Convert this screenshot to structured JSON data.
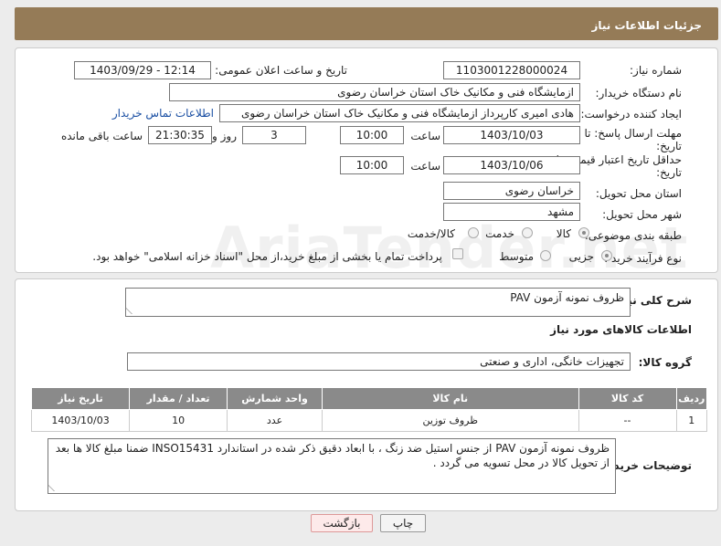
{
  "header": {
    "title": "جزئیات اطلاعات نیاز"
  },
  "fields": {
    "need_number_label": "شماره نیاز:",
    "need_number": "1103001228000024",
    "announce_label": "تاریخ و ساعت اعلان عمومی:",
    "announce_value": "1403/09/29 - 12:14",
    "buyer_org_label": "نام دستگاه خریدار:",
    "buyer_org": "ازمایشگاه فنی و مکانیک خاک استان خراسان رضوی",
    "creator_label": "ایجاد کننده درخواست:",
    "creator": "هادی  امیری کارپرداز ازمایشگاه فنی و مکانیک خاک استان خراسان رضوی",
    "contact_link": "اطلاعات تماس خریدار",
    "deadline_label_1": "مهلت ارسال پاسخ: تا",
    "deadline_label_2": "تاریخ:",
    "deadline_date": "1403/10/03",
    "time_label": "ساعت",
    "deadline_time": "10:00",
    "days_value": "3",
    "days_label": "روز و",
    "remaining_time": "21:30:35",
    "remaining_label": "ساعت باقی مانده",
    "validity_label_1": "حداقل تاریخ اعتبار قیمت: تا",
    "validity_label_2": "تاریخ:",
    "validity_date": "1403/10/06",
    "validity_time": "10:00",
    "province_label": "استان محل تحویل:",
    "province": "خراسان رضوی",
    "city_label": "شهر محل تحویل:",
    "city": "مشهد",
    "category_label": "طبقه بندی موضوعی:",
    "category_options": [
      "کالا",
      "خدمت",
      "کالا/خدمت"
    ],
    "process_label": "نوع فرآیند خرید :",
    "process_options": [
      "جزیی",
      "متوسط"
    ],
    "payment_note": "پرداخت تمام یا بخشی از مبلغ خرید،از محل \"اسناد خزانه اسلامی\" خواهد بود."
  },
  "description": {
    "label": "شرح کلی نیاز:",
    "value": "ظروف نمونه آزمون PAV"
  },
  "goods": {
    "section_title": "اطلاعات کالاهای مورد نیاز",
    "group_label": "گروه کالا:",
    "group_value": "تجهیزات خانگی، اداری و صنعتی",
    "columns": [
      "ردیف",
      "کد کالا",
      "نام کالا",
      "واحد شمارش",
      "تعداد / مقدار",
      "تاریخ نیاز"
    ],
    "rows": [
      [
        "1",
        "--",
        "ظروف توزین",
        "عدد",
        "10",
        "1403/10/03"
      ]
    ]
  },
  "buyer_notes": {
    "label": "توضیحات خریدار:",
    "value": "ظروف نمونه آزمون PAV از جنس استیل ضد زنگ ، با ابعاد دقیق ذکر شده در استاندارد INSO15431 ضمنا مبلغ کالا ها بعد از تحویل کالا در محل تسویه می گردد ."
  },
  "buttons": {
    "print": "چاپ",
    "back": "بازگشت"
  },
  "watermark": "AriaTender.net"
}
